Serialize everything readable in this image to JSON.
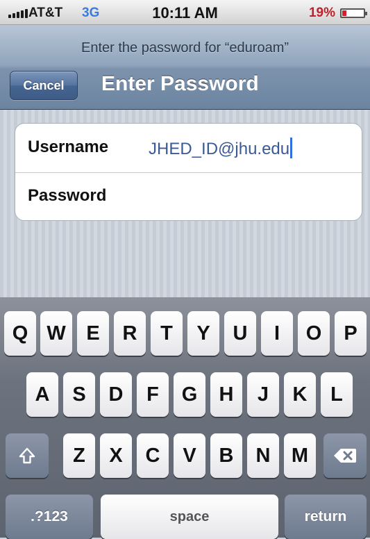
{
  "status_bar": {
    "carrier": "AT&T",
    "network": "3G",
    "time": "10:11 AM",
    "battery_percent": "19%",
    "battery_level": 0.19,
    "icons": [
      "signal-bars-icon",
      "battery-icon"
    ]
  },
  "navbar": {
    "prompt": "Enter the password for “eduroam”",
    "cancel_label": "Cancel",
    "title": "Enter Password"
  },
  "form": {
    "username_label": "Username",
    "username_value": "JHED_ID@jhu.edu",
    "password_label": "Password",
    "password_value": ""
  },
  "keyboard": {
    "row1": [
      "Q",
      "W",
      "E",
      "R",
      "T",
      "Y",
      "U",
      "I",
      "O",
      "P"
    ],
    "row2": [
      "A",
      "S",
      "D",
      "F",
      "G",
      "H",
      "J",
      "K",
      "L"
    ],
    "row3": [
      "Z",
      "X",
      "C",
      "V",
      "B",
      "N",
      "M"
    ],
    "numbers_label": ".?123",
    "space_label": "space",
    "return_label": "return",
    "icons": [
      "shift-icon",
      "backspace-icon"
    ]
  },
  "colors": {
    "navbar": "#7d93ad",
    "cancel_button": "#45648f",
    "network_blue": "#3a7be0",
    "battery_red": "#c0202a",
    "input_text": "#3a5a96"
  }
}
